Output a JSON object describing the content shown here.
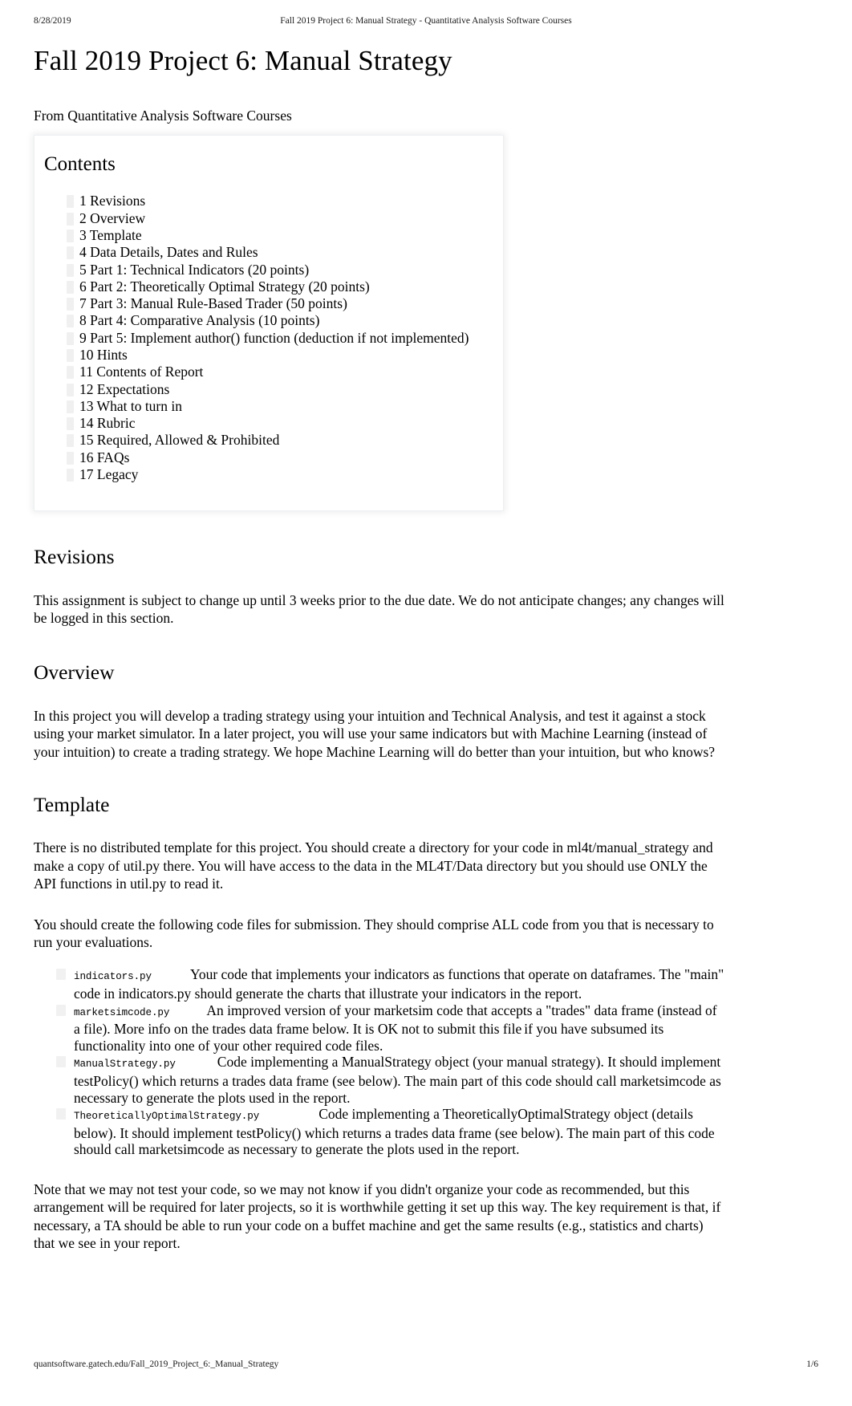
{
  "print_header": {
    "date": "8/28/2019",
    "title": "Fall 2019 Project 6: Manual Strategy - Quantitative Analysis Software Courses"
  },
  "document": {
    "title": "Fall 2019 Project 6: Manual Strategy",
    "from_line": "From Quantitative Analysis Software Courses"
  },
  "toc": {
    "heading": "Contents",
    "items": [
      "1 Revisions",
      "2 Overview",
      "3 Template",
      "4 Data Details, Dates and Rules",
      "5 Part 1: Technical Indicators (20 points)",
      "6 Part 2: Theoretically Optimal Strategy (20 points)",
      "7 Part 3: Manual Rule-Based Trader (50 points)",
      "8 Part 4: Comparative Analysis (10 points)",
      "9 Part 5: Implement author() function (deduction if not implemented)",
      "10 Hints",
      "11 Contents of Report",
      "12 Expectations",
      "13 What to turn in",
      "14 Rubric",
      "15 Required, Allowed & Prohibited",
      "16 FAQs",
      "17 Legacy"
    ]
  },
  "sections": {
    "revisions": {
      "heading": "Revisions",
      "paragraph": "This assignment is subject to change up until 3 weeks prior to the due date. We do not anticipate changes; any changes will be logged in this section."
    },
    "overview": {
      "heading": "Overview",
      "paragraph": "In this project you will develop a trading strategy using your intuition and Technical Analysis, and test it against a stock using your market simulator. In a later project, you will use your same indicators but with Machine Learning (instead of your intuition) to create a trading strategy. We hope Machine Learning will do better than your intuition, but who knows?"
    },
    "template": {
      "heading": "Template",
      "paragraph_1": "There is no distributed template for this project. You should create a directory for your code in ml4t/manual_strategy and make a copy of util.py there. You will have access to the data in the ML4T/Data directory but you should use ONLY the API functions in util.py to read it.",
      "paragraph_2": "You should create the following code files for submission. They should comprise ALL code from you that is necessary to run your evaluations.",
      "files": [
        {
          "name": "indicators.py",
          "description": "Your code that implements your indicators as functions that operate on dataframes. The \"main\" code in indicators.py should generate the charts that illustrate your indicators in the report."
        },
        {
          "name": "marketsimcode.py",
          "description_a": "An improved version of your marketsim code that accepts a \"trades\" data frame (instead of a file). More info on the trades data frame below. It is OK not to submit this file",
          "description_b": "if you have subsumed its functionality into one of your other required code files."
        },
        {
          "name": "ManualStrategy.py",
          "description": "Code implementing a ManualStrategy object (your manual strategy). It should implement testPolicy() which returns a trades data frame (see below). The main part of this code should call marketsimcode as necessary to generate the plots used in the report."
        },
        {
          "name": "TheoreticallyOptimalStrategy.py",
          "description": "Code implementing a TheoreticallyOptimalStrategy object (details below). It should implement testPolicy() which returns a trades data frame (see below). The main part of this code should call marketsimcode as necessary to generate the plots used in the report."
        }
      ],
      "paragraph_3": "Note that we may not test your code, so we may not know if you didn't organize your code as recommended, but this arrangement will be required for later projects, so it is worthwhile getting it set up this way. The key requirement is that, if necessary, a TA should be able to run your code on a buffet machine and get the same results (e.g., statistics and charts) that we see in your report."
    }
  },
  "print_footer": {
    "url": "quantsoftware.gatech.edu/Fall_2019_Project_6:_Manual_Strategy",
    "page": "1/6"
  }
}
